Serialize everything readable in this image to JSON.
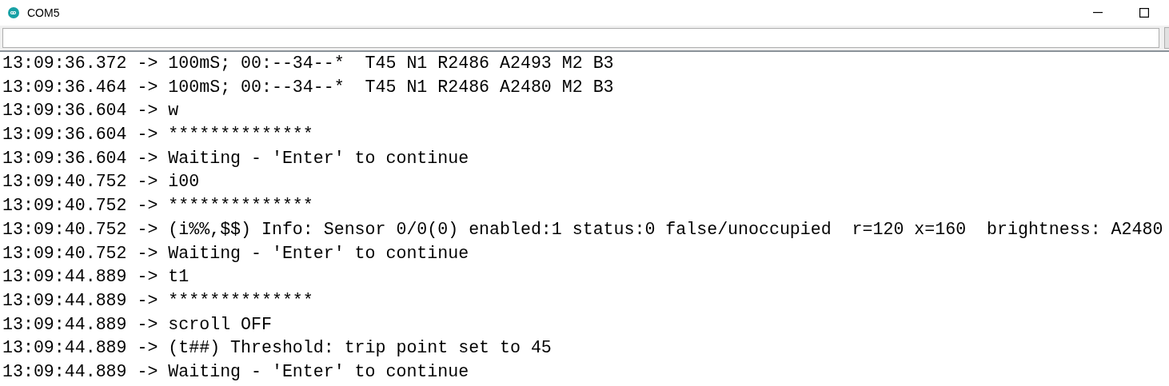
{
  "window": {
    "title": "COM5"
  },
  "lines": [
    "13:09:36.372 -> 100mS; 00:--34--*  T45 N1 R2486 A2493 M2 B3",
    "13:09:36.464 -> 100mS; 00:--34--*  T45 N1 R2486 A2480 M2 B3",
    "13:09:36.604 -> w",
    "13:09:36.604 -> **************",
    "13:09:36.604 -> Waiting - 'Enter' to continue",
    "13:09:40.752 -> i00",
    "13:09:40.752 -> **************",
    "13:09:40.752 -> (i%%,$$) Info: Sensor 0/0(0) enabled:1 status:0 false/unoccupied  r=120 x=160  brightness: A2480",
    "13:09:40.752 -> Waiting - 'Enter' to continue",
    "13:09:44.889 -> t1",
    "13:09:44.889 -> **************",
    "13:09:44.889 -> scroll OFF",
    "13:09:44.889 -> (t##) Threshold: trip point set to 45",
    "13:09:44.889 -> Waiting - 'Enter' to continue"
  ]
}
